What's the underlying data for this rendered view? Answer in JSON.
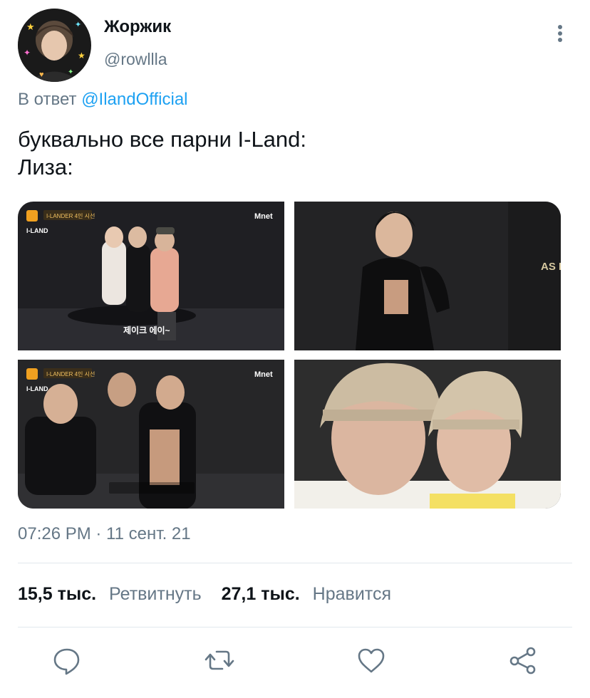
{
  "author": {
    "display_name": "Жоржик",
    "handle": "@rowllla"
  },
  "reply": {
    "prefix": "В ответ",
    "mention": "@IlandOfficial"
  },
  "tweet": {
    "lines": [
      "буквально все парни I-Land:",
      "Лиза:"
    ]
  },
  "media": {
    "photos": [
      {
        "overlay_top": "I-LANDER 4인 시선",
        "network": "Mnet",
        "logo": "I-LAND",
        "caption": "제이크 에이~"
      },
      {
        "overlay_top": "",
        "network": "",
        "logo": "",
        "caption": ""
      },
      {
        "overlay_top": "I-LANDER 4인 시선",
        "network": "Mnet",
        "logo": "I-LAND",
        "caption": ""
      },
      {
        "overlay_top": "",
        "network": "",
        "logo": "",
        "caption": ""
      }
    ]
  },
  "meta": {
    "timestamp": "07:26 PM · 11 сент. 21"
  },
  "stats": {
    "retweets_count": "15,5 тыс.",
    "retweets_label": "Ретвитнуть",
    "likes_count": "27,1 тыс.",
    "likes_label": "Нравится"
  },
  "icons": {
    "reply": "speech-bubble-icon",
    "retweet": "retweet-arrows-icon",
    "like": "heart-icon",
    "share": "share-nodes-icon",
    "more": "vertical-dots-icon"
  },
  "colors": {
    "link": "#1da1f2",
    "secondary_text": "#657786",
    "icon": "#657786"
  }
}
